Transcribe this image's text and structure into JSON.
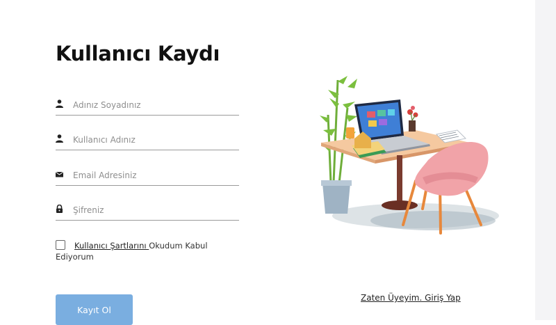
{
  "form": {
    "title": "Kullanıcı Kaydı",
    "fields": [
      {
        "icon": "person-icon",
        "placeholder": "Adınız Soyadınız",
        "value": ""
      },
      {
        "icon": "person-icon",
        "placeholder": "Kullanıcı Adınız",
        "value": ""
      },
      {
        "icon": "envelope-icon",
        "placeholder": "Email Adresiniz",
        "value": ""
      },
      {
        "icon": "lock-icon",
        "placeholder": "Şifreniz",
        "value": ""
      }
    ],
    "terms": {
      "checked": false,
      "link_text": "Kullanıcı Şartlarını ",
      "suffix_text": "Okudum Kabul Ediyorum"
    },
    "submit_label": "Kayıt Ol"
  },
  "login_link": "Zaten Üyeyim. Giriş Yap",
  "illustration": {
    "icon": "desk-workspace-illustration"
  },
  "colors": {
    "button": "#7aaee0",
    "text": "#111111",
    "underline": "#9a9a9a"
  }
}
